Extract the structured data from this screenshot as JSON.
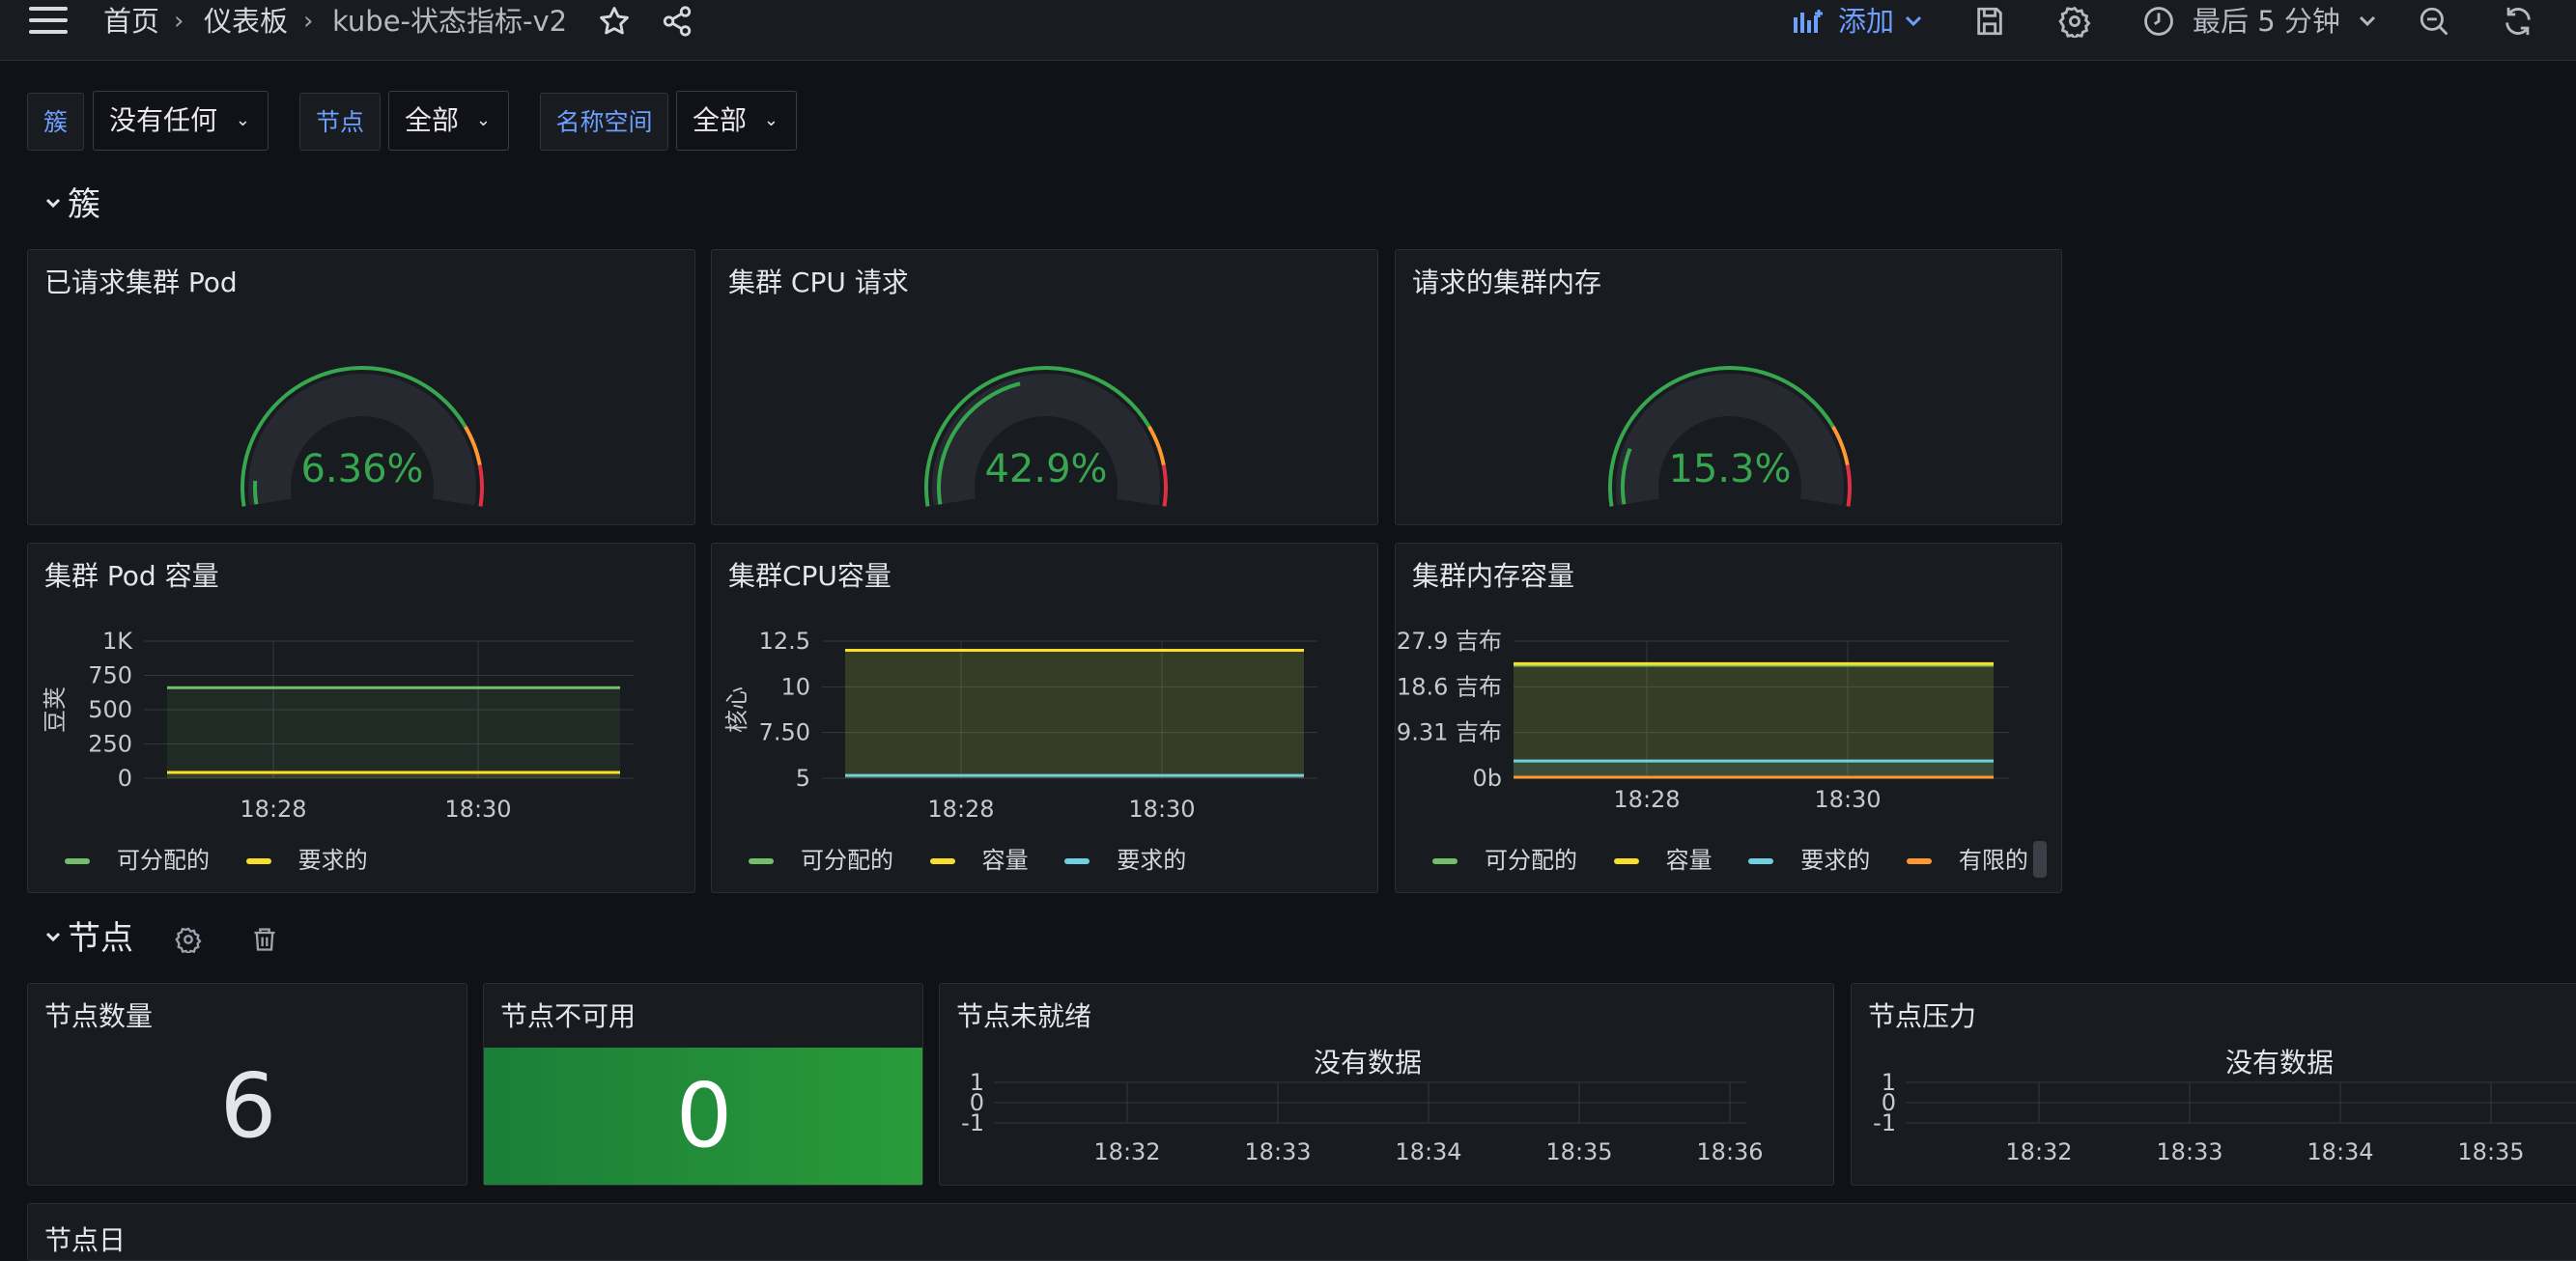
{
  "topbar": {
    "breadcrumb": [
      "首页",
      "仪表板",
      "kube-状态指标-v2"
    ],
    "add_label": "添加",
    "time_range": "最后 5 分钟"
  },
  "variables": [
    {
      "label": "簇",
      "value": "没有任何"
    },
    {
      "label": "节点",
      "value": "全部"
    },
    {
      "label": "名称空间",
      "value": "全部"
    }
  ],
  "rows": {
    "cluster": "簇",
    "nodes": "节点"
  },
  "gauges": [
    {
      "title": "已请求集群 Pod",
      "value": "6.36%",
      "percent": 6.36
    },
    {
      "title": "集群 CPU 请求",
      "value": "42.9%",
      "percent": 42.9
    },
    {
      "title": "请求的集群内存",
      "value": "15.3%",
      "percent": 15.3
    }
  ],
  "colors": {
    "green": "#73bf69",
    "yellow": "#fade2a",
    "blue": "#8ab8ff",
    "cyan": "#6ed0e0",
    "orange": "#ff9830",
    "accent": "#6e9fff",
    "gauge_green": "#36a64f",
    "stat_green": "#1a7f37"
  },
  "chart_data": [
    {
      "type": "line",
      "title": "集群 Pod 容量",
      "ylabel": "豆荚",
      "ylim": [
        0,
        1000
      ],
      "yticks": [
        "1K",
        "750",
        "500",
        "250",
        "0"
      ],
      "xticks": [
        "18:28",
        "18:30"
      ],
      "series": [
        {
          "name": "可分配的",
          "values": [
            660,
            660
          ],
          "color": "#73bf69"
        },
        {
          "name": "要求的",
          "values": [
            42,
            42
          ],
          "color": "#fade2a"
        }
      ]
    },
    {
      "type": "line",
      "title": "集群CPU容量",
      "ylabel": "核心",
      "ylim": [
        5,
        12.5
      ],
      "yticks": [
        "12.5",
        "10",
        "7.50",
        "5"
      ],
      "xticks": [
        "18:28",
        "18:30"
      ],
      "series": [
        {
          "name": "可分配的",
          "values": [
            12,
            12
          ],
          "color": "#73bf69"
        },
        {
          "name": "容量",
          "values": [
            12,
            12
          ],
          "color": "#fade2a"
        },
        {
          "name": "要求的",
          "values": [
            5.15,
            5.15
          ],
          "color": "#6ed0e0"
        }
      ]
    },
    {
      "type": "line",
      "title": "集群内存容量",
      "ylabel": "",
      "yticks": [
        "27.9 吉布",
        "18.6 吉布",
        "9.31 吉布",
        "0b"
      ],
      "xticks": [
        "18:28",
        "18:30"
      ],
      "series": [
        {
          "name": "可分配的",
          "values": [
            23.0,
            23.0
          ],
          "color": "#73bf69"
        },
        {
          "name": "容量",
          "values": [
            23.3,
            23.3
          ],
          "color": "#fade2a"
        },
        {
          "name": "要求的",
          "values": [
            3.5,
            3.5
          ],
          "color": "#6ed0e0"
        },
        {
          "name": "有限的",
          "values": [
            0.2,
            0.2
          ],
          "color": "#ff9830"
        }
      ]
    },
    {
      "type": "line",
      "title": "节点未就绪",
      "no_data": "没有数据",
      "yticks": [
        "1",
        "0",
        "-1"
      ],
      "xticks": [
        "18:32",
        "18:33",
        "18:34",
        "18:35",
        "18:36"
      ]
    },
    {
      "type": "line",
      "title": "节点压力",
      "no_data": "没有数据",
      "yticks": [
        "1",
        "0",
        "-1"
      ],
      "xticks": [
        "18:32",
        "18:33",
        "18:34",
        "18:35"
      ]
    }
  ],
  "stats": [
    {
      "title": "节点数量",
      "value": "6"
    },
    {
      "title": "节点不可用",
      "value": "0"
    }
  ],
  "bottom_row": "节点日"
}
